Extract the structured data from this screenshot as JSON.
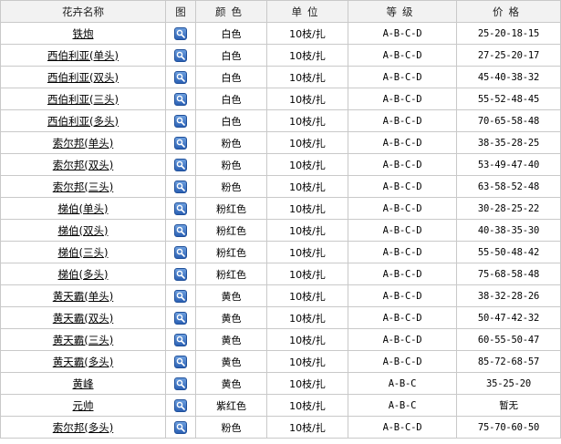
{
  "headers": {
    "name": "花卉名称",
    "image": "图",
    "color": "颜色",
    "unit": "单位",
    "grade": "等级",
    "price": "价格"
  },
  "rows": [
    {
      "name": "铁炮",
      "color": "白色",
      "unit": "10枝/扎",
      "grade": "A-B-C-D",
      "price": "25-20-18-15"
    },
    {
      "name": "西伯利亚(单头)",
      "color": "白色",
      "unit": "10枝/扎",
      "grade": "A-B-C-D",
      "price": "27-25-20-17"
    },
    {
      "name": "西伯利亚(双头)",
      "color": "白色",
      "unit": "10枝/扎",
      "grade": "A-B-C-D",
      "price": "45-40-38-32"
    },
    {
      "name": "西伯利亚(三头)",
      "color": "白色",
      "unit": "10枝/扎",
      "grade": "A-B-C-D",
      "price": "55-52-48-45"
    },
    {
      "name": "西伯利亚(多头)",
      "color": "白色",
      "unit": "10枝/扎",
      "grade": "A-B-C-D",
      "price": "70-65-58-48"
    },
    {
      "name": "索尔邦(单头)",
      "color": "粉色",
      "unit": "10枝/扎",
      "grade": "A-B-C-D",
      "price": "38-35-28-25"
    },
    {
      "name": "索尔邦(双头)",
      "color": "粉色",
      "unit": "10枝/扎",
      "grade": "A-B-C-D",
      "price": "53-49-47-40"
    },
    {
      "name": "索尔邦(三头)",
      "color": "粉色",
      "unit": "10枝/扎",
      "grade": "A-B-C-D",
      "price": "63-58-52-48"
    },
    {
      "name": "梯伯(单头)",
      "color": "粉红色",
      "unit": "10枝/扎",
      "grade": "A-B-C-D",
      "price": "30-28-25-22"
    },
    {
      "name": "梯伯(双头)",
      "color": "粉红色",
      "unit": "10枝/扎",
      "grade": "A-B-C-D",
      "price": "40-38-35-30"
    },
    {
      "name": "梯伯(三头)",
      "color": "粉红色",
      "unit": "10枝/扎",
      "grade": "A-B-C-D",
      "price": "55-50-48-42"
    },
    {
      "name": "梯伯(多头)",
      "color": "粉红色",
      "unit": "10枝/扎",
      "grade": "A-B-C-D",
      "price": "75-68-58-48"
    },
    {
      "name": "黄天霸(单头)",
      "color": "黄色",
      "unit": "10枝/扎",
      "grade": "A-B-C-D",
      "price": "38-32-28-26"
    },
    {
      "name": "黄天霸(双头)",
      "color": "黄色",
      "unit": "10枝/扎",
      "grade": "A-B-C-D",
      "price": "50-47-42-32"
    },
    {
      "name": "黄天霸(三头)",
      "color": "黄色",
      "unit": "10枝/扎",
      "grade": "A-B-C-D",
      "price": "60-55-50-47"
    },
    {
      "name": "黄天霸(多头)",
      "color": "黄色",
      "unit": "10枝/扎",
      "grade": "A-B-C-D",
      "price": "85-72-68-57"
    },
    {
      "name": "黄峰",
      "color": "黄色",
      "unit": "10枝/扎",
      "grade": "A-B-C",
      "price": "35-25-20"
    },
    {
      "name": "元帅",
      "color": "紫红色",
      "unit": "10枝/扎",
      "grade": "A-B-C",
      "price": "暂无"
    },
    {
      "name": "索尔邦(多头)",
      "color": "粉色",
      "unit": "10枝/扎",
      "grade": "A-B-C-D",
      "price": "75-70-60-50"
    }
  ],
  "icon": "magnifier-icon",
  "colors": {
    "border": "#c9c9c9",
    "header_bg": "#f2f2f2",
    "icon_blue": "#2b61b5"
  }
}
